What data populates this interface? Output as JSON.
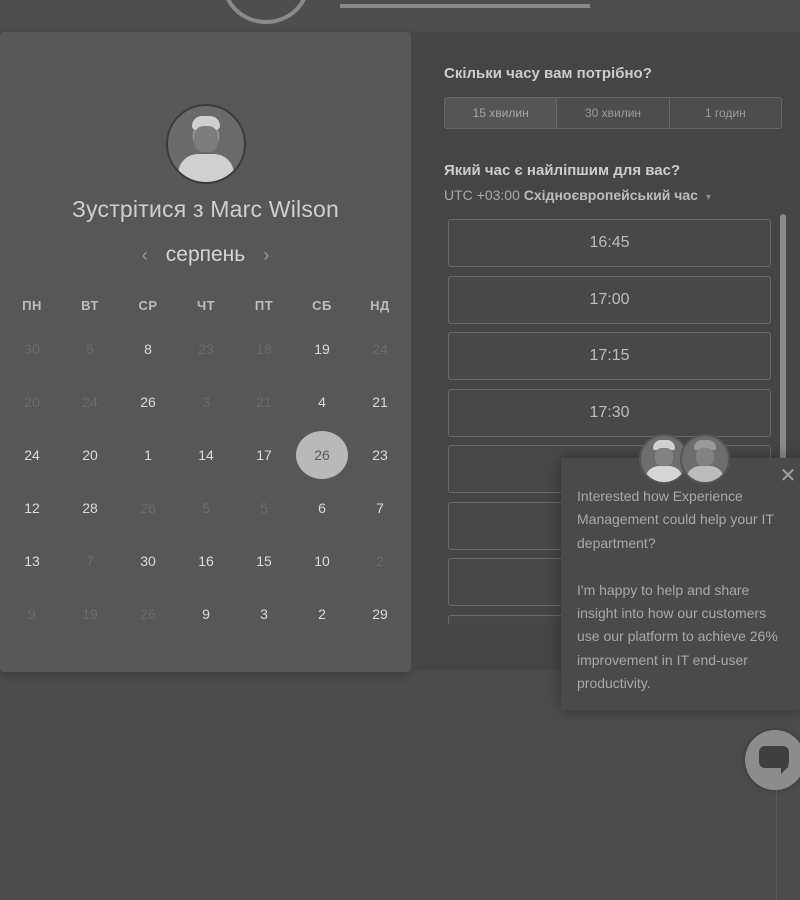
{
  "calendar": {
    "title": "Зустрітися з Marc Wilson",
    "month": "серпень",
    "prev_arrow": "‹",
    "next_arrow": "›",
    "weekdays": [
      "ПН",
      "ВТ",
      "СР",
      "ЧТ",
      "ПТ",
      "СБ",
      "НД"
    ],
    "rows": [
      [
        {
          "d": "30",
          "m": true
        },
        {
          "d": "5",
          "m": true
        },
        {
          "d": "8",
          "m": false
        },
        {
          "d": "23",
          "m": true
        },
        {
          "d": "18",
          "m": true
        },
        {
          "d": "19",
          "m": false
        },
        {
          "d": "24",
          "m": true
        }
      ],
      [
        {
          "d": "20",
          "m": true
        },
        {
          "d": "24",
          "m": true
        },
        {
          "d": "26",
          "m": false
        },
        {
          "d": "3",
          "m": true
        },
        {
          "d": "21",
          "m": true
        },
        {
          "d": "4",
          "m": false
        },
        {
          "d": "21",
          "m": false
        }
      ],
      [
        {
          "d": "24",
          "m": false
        },
        {
          "d": "20",
          "m": false
        },
        {
          "d": "1",
          "m": false
        },
        {
          "d": "14",
          "m": false
        },
        {
          "d": "17",
          "m": false
        },
        {
          "d": "26",
          "m": false,
          "selected": true
        },
        {
          "d": "23",
          "m": false
        }
      ],
      [
        {
          "d": "12",
          "m": false
        },
        {
          "d": "28",
          "m": false
        },
        {
          "d": "26",
          "m": true
        },
        {
          "d": "5",
          "m": true
        },
        {
          "d": "5",
          "m": true
        },
        {
          "d": "6",
          "m": false
        },
        {
          "d": "7",
          "m": false
        }
      ],
      [
        {
          "d": "13",
          "m": false
        },
        {
          "d": "7",
          "m": true
        },
        {
          "d": "30",
          "m": false
        },
        {
          "d": "16",
          "m": false
        },
        {
          "d": "15",
          "m": false
        },
        {
          "d": "10",
          "m": false
        },
        {
          "d": "2",
          "m": true
        }
      ],
      [
        {
          "d": "9",
          "m": true
        },
        {
          "d": "19",
          "m": true
        },
        {
          "d": "26",
          "m": true
        },
        {
          "d": "9",
          "m": false
        },
        {
          "d": "3",
          "m": false
        },
        {
          "d": "2",
          "m": false
        },
        {
          "d": "29",
          "m": false
        }
      ]
    ]
  },
  "booking": {
    "duration_heading": "Скільки часу вам потрібно?",
    "durations": [
      "15 хвилин",
      "30 хвилин",
      "1 годин"
    ],
    "time_heading": "Який час є найліпшим для вас?",
    "tz_offset": "UTC +03:00",
    "tz_name": "Східноєвропейський час",
    "tz_caret": "▾",
    "slots": [
      "16:45",
      "17:00",
      "17:15",
      "17:30",
      "",
      "",
      "",
      ""
    ]
  },
  "popup": {
    "close": "✕",
    "paragraph1": "Interested how Experience Management could help your IT department?",
    "paragraph2": "I'm happy to help and share insight into how our customers use our platform to achieve 26% improvement in IT end-user productivity."
  },
  "colors": {
    "background": "#4c4c4c",
    "card": "#575757",
    "panel": "#454545",
    "selected_day": "#b9b9b9"
  }
}
